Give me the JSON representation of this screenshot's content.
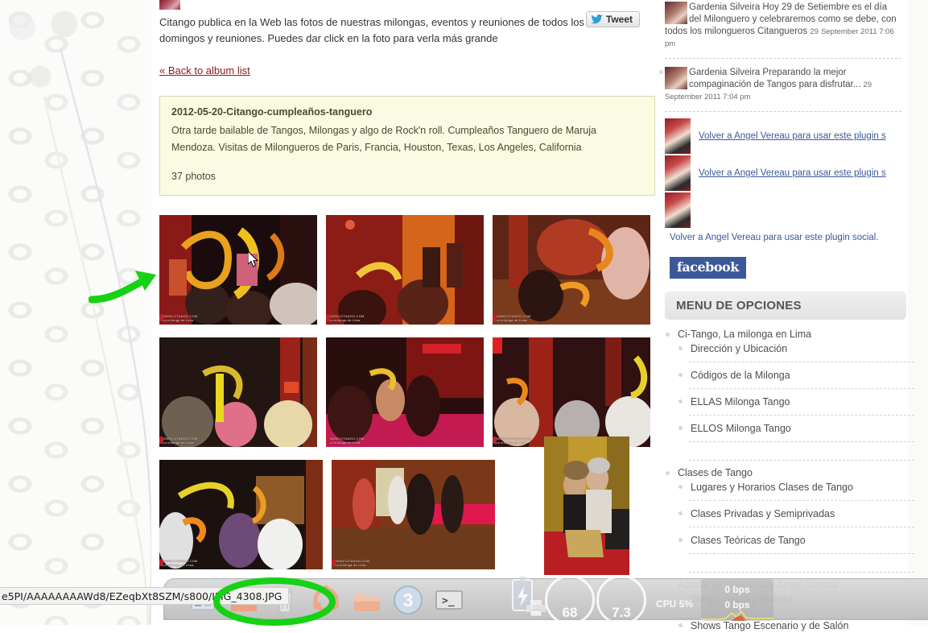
{
  "main": {
    "intro": "Citango publica en la Web las fotos de nuestras milongas, eventos y reuniones de todos los domingos y reuniones. Puedes dar click en la foto para verla más grande",
    "tweet_label": "Tweet",
    "back_link": "« Back to album list",
    "album": {
      "title": "2012-05-20-Citango-cumpleaños-tanguero",
      "description": "Otra tarde bailable de Tangos, Milongas y algo de Rock'n roll. Cumpleaños Tanguero de Maruja Mendoza. Visitas de Milongueros de Paris, Francia, Houston, Texas, Los Angeles, California",
      "count": "37 photos"
    },
    "watermark": {
      "line1": "WWW.CITANGO.COM",
      "line2": "La milonga de Lima"
    }
  },
  "sidebar": {
    "facebook_posts": [
      {
        "text": "Gardenia Silveira Hoy 29 de Setiembre es el día del Milonguero y celebraremos como se debe, con todos los milongueros Citangueros",
        "date_inline": "29",
        "date": "September 2011 7:06 pm"
      },
      {
        "text": "Gardenia Silveira Preparando la mejor compaginación de Tangos para disfrutar...",
        "date_inline": "29",
        "date": "September 2011 7:04 pm"
      }
    ],
    "plugin_links": [
      "Volver a Angel Vereau para usar este plugin s",
      "Volver a Angel Vereau para usar este plugin s"
    ],
    "plugin_final": "Volver a Angel Vereau para usar este plugin social.",
    "facebook_logo": "facebook",
    "menu_title": "MENU DE OPCIONES",
    "menu_groups": [
      {
        "top": "Ci-Tango, La milonga en Lima",
        "subs": [
          "Dirección y Ubicación",
          "Códigos de la Milonga",
          "ELLAS Milonga Tango",
          "ELLOS Milonga Tango"
        ]
      },
      {
        "top": "Clases de Tango",
        "subs": [
          "Lugares y Horarios Clases de Tango",
          "Clases Privadas y Semiprivadas",
          "Clases Teóricas de Tango"
        ]
      },
      {
        "top": "Acerca de Gardenia y Angel Vereau",
        "subs": [
          "Tango, Salud y Belleza",
          "Shows Tango Escenario y de Salón"
        ]
      }
    ]
  },
  "dock": {
    "status_url": "e5PI/AAAAAAAAWd8/EZeqbXt8SZM/s800/IMG_4308.JPG",
    "badge_count": "3",
    "terminal_glyph": ">_",
    "gauge_left": "68",
    "gauge_right": "7.3",
    "cpu_label": "CPU 5%",
    "net_up": "0 bps",
    "net_down": "0 bps",
    "icons": [
      "file-manager-icon",
      "folder-icon",
      "trash-icon",
      "ubuntu-logo-icon",
      "folder-orange-icon",
      "workspace-badge-icon",
      "terminal-icon",
      "battery-icon",
      "printer-icon"
    ]
  },
  "colors": {
    "link": "#3b5998",
    "accent_red": "#8b1a1a",
    "album_bg": "#fbfbe3",
    "annotation_green": "#1fd81f"
  }
}
